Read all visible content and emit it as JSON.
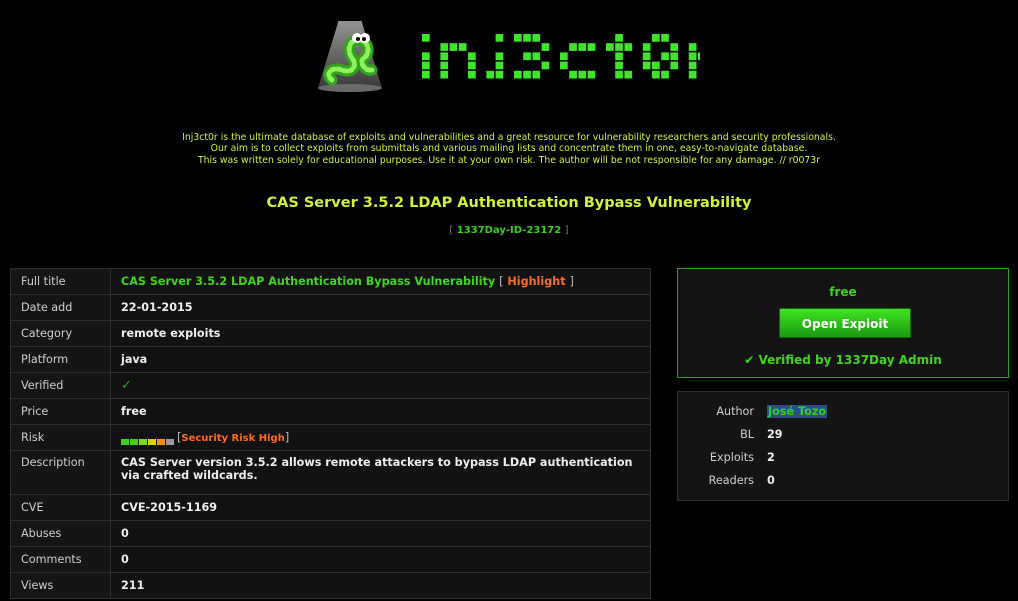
{
  "header": {
    "logo_text": "inj3ct0r",
    "intro": [
      "Inj3ct0r is the ultimate database of exploits and vulnerabilities and a great resource for vulnerability researchers and security professionals.",
      "Our aim is to collect exploits from submittals and various mailing lists and concentrate them in one, easy-to-navigate database.",
      "This was written solely for educational purposes. Use it at your own risk. The author will be not responsible for any damage. // r0073r"
    ]
  },
  "exploit": {
    "title": "CAS Server 3.5.2 LDAP Authentication Bypass Vulnerability",
    "id_open": "[",
    "id": "1337Day-ID-23172",
    "id_close": "]"
  },
  "details": {
    "full_title": {
      "label": "Full title",
      "value": "CAS Server 3.5.2 LDAP Authentication Bypass Vulnerability",
      "bracket_open": "[",
      "highlight": "Highlight",
      "bracket_close": "]"
    },
    "date_add": {
      "label": "Date add",
      "value": "22-01-2015"
    },
    "category": {
      "label": "Category",
      "value": "remote exploits"
    },
    "platform": {
      "label": "Platform",
      "value": "java"
    },
    "verified": {
      "label": "Verified",
      "value": "✓"
    },
    "price": {
      "label": "Price",
      "value": "free"
    },
    "risk": {
      "label": "Risk",
      "bracket_open": "[",
      "value": "Security Risk High",
      "bracket_close": "]",
      "bar_colors": [
        "#3ed21b",
        "#3ed21b",
        "#79d91c",
        "#d7d21a",
        "#ff8a1c",
        "#9a9a9a"
      ]
    },
    "description": {
      "label": "Description",
      "line1": "CAS Server version 3.5.2 allows remote attackers to bypass LDAP authentication",
      "line2": "via crafted wildcards."
    },
    "cve": {
      "label": "CVE",
      "value": "CVE-2015-1169"
    },
    "abuses": {
      "label": "Abuses",
      "value": "0"
    },
    "comments": {
      "label": "Comments",
      "value": "0"
    },
    "views": {
      "label": "Views",
      "value": "211"
    }
  },
  "purchase": {
    "price": "free",
    "open_button": "Open Exploit",
    "verified_icon": "✔",
    "verified_text": "Verified by 1337Day Admin"
  },
  "author": {
    "author_label": "Author",
    "author_value": "José Tozo",
    "bl_label": "BL",
    "bl_value": "29",
    "exploits_label": "Exploits",
    "exploits_value": "2",
    "readers_label": "Readers",
    "readers_value": "0"
  },
  "colors": {
    "accent_green": "#3fd51b",
    "title_yellow": "#d0f23a",
    "risk_orange": "#ff6b1f",
    "border_green": "#2c9c1c"
  }
}
